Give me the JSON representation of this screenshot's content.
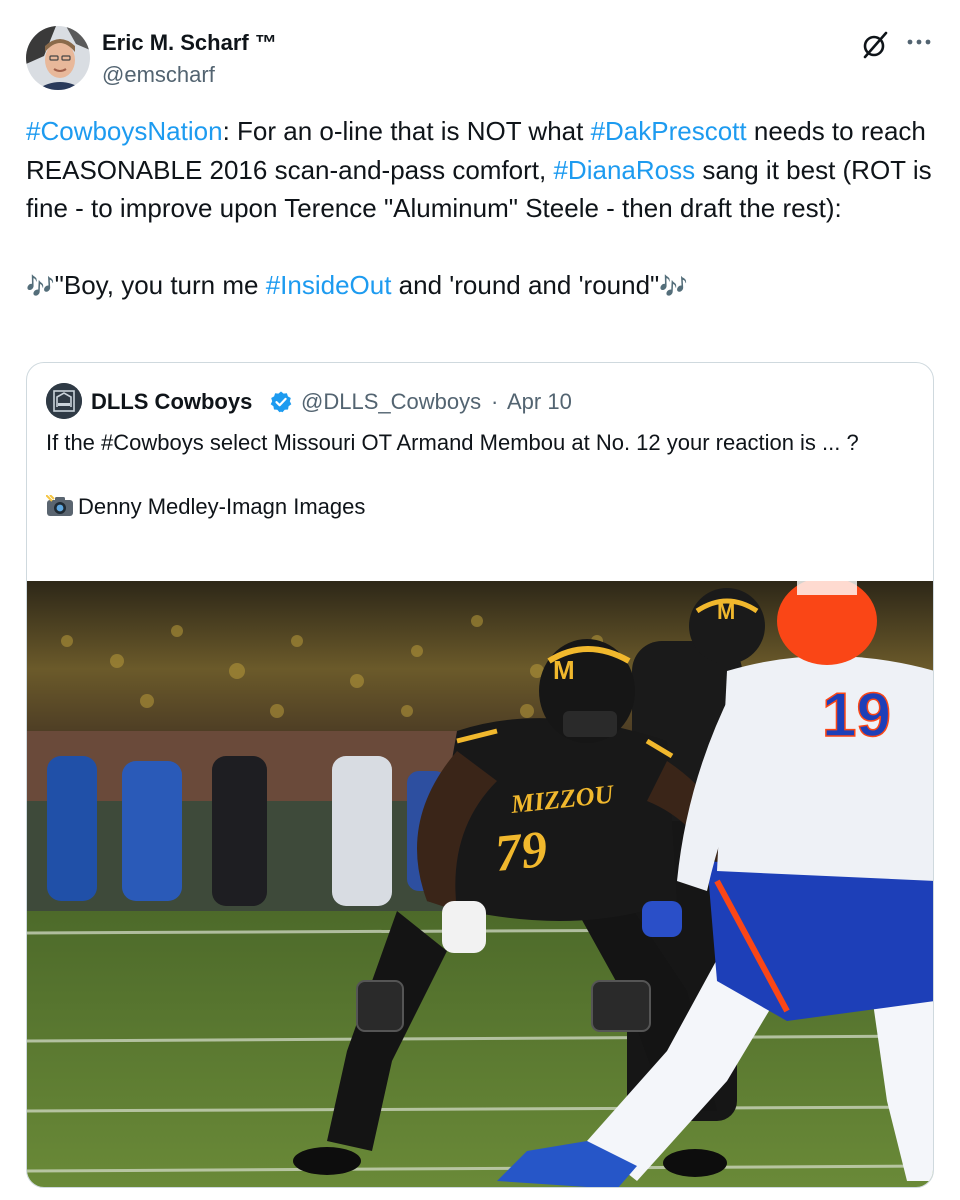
{
  "author": {
    "name": "Eric M. Scharf ™",
    "handle": "@emscharf"
  },
  "tweet": {
    "line1": {
      "tag1": "#CowboysNation",
      "t1": ": For an o-line that is NOT what ",
      "tag2": "#DakPrescott",
      "t2": " needs to reach REASONABLE 2016 scan-and-pass comfort, ",
      "tag3": "#DianaRoss",
      "t3": " sang it best (ROT is fine - to improve upon Terence \"Aluminum\" Steele - then draft the rest):"
    },
    "line2": {
      "note_left": "🎶",
      "t1": "\"Boy, you turn me ",
      "tag": "#InsideOut",
      "t2": " and 'round and 'round\"",
      "note_right": "🎶"
    }
  },
  "quote": {
    "name": "DLLS Cowboys",
    "handle": "@DLLS_Cowboys",
    "separator": "·",
    "date": "Apr 10",
    "text": "If the #Cowboys select Missouri OT Armand Membou at No. 12 your reaction is ... ?",
    "credit": "Denny Medley-Imagn Images",
    "photo_text": {
      "jersey_player": "79",
      "jersey_team": "MIZZOU",
      "jersey_opponent": "19",
      "helmet_logo": "M"
    }
  },
  "colors": {
    "link": "#1d9bf0",
    "text": "#0f1419",
    "secondary": "#536471",
    "border": "#cfd9de",
    "field": "#5a7a2e",
    "mizzou_gold": "#f1b82d",
    "gator_orange": "#fa4616",
    "gator_blue": "#0021a5"
  },
  "icons": [
    "grok-icon",
    "more-icon",
    "verified-badge-icon",
    "camera-icon",
    "music-notes-icon"
  ]
}
